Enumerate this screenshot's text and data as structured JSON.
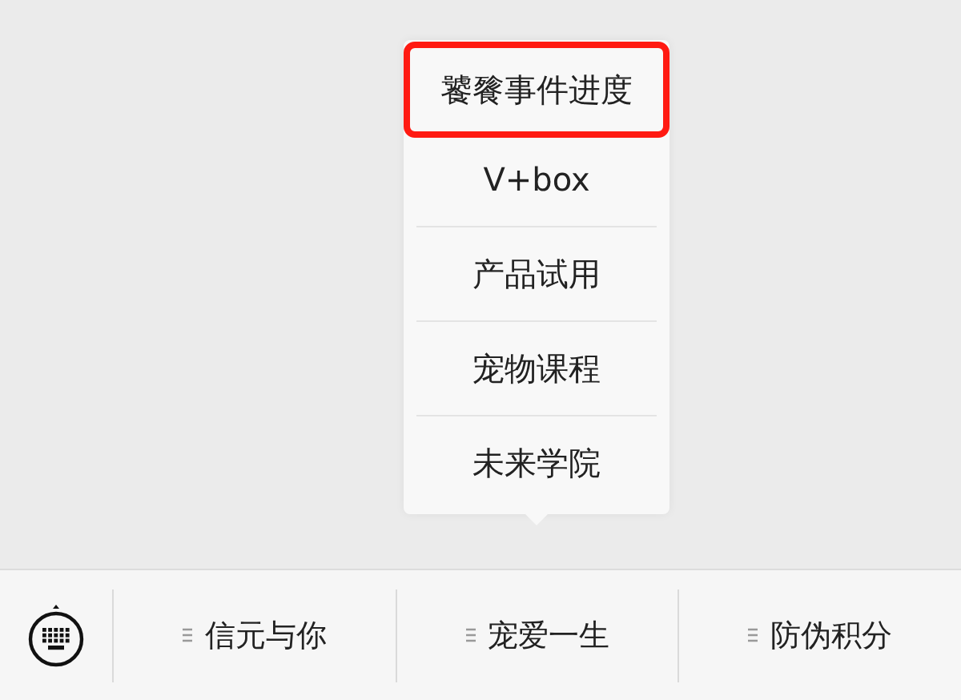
{
  "popup_menu": {
    "items": [
      {
        "label": "饕餮事件进度",
        "highlighted": true
      },
      {
        "label": "V+box",
        "highlighted": false
      },
      {
        "label": "产品试用",
        "highlighted": false
      },
      {
        "label": "宠物课程",
        "highlighted": false
      },
      {
        "label": "未来学院",
        "highlighted": false
      }
    ]
  },
  "bottom_menu": {
    "tabs": [
      {
        "label": "信元与你"
      },
      {
        "label": "宠爱一生"
      },
      {
        "label": "防伪积分"
      }
    ]
  }
}
